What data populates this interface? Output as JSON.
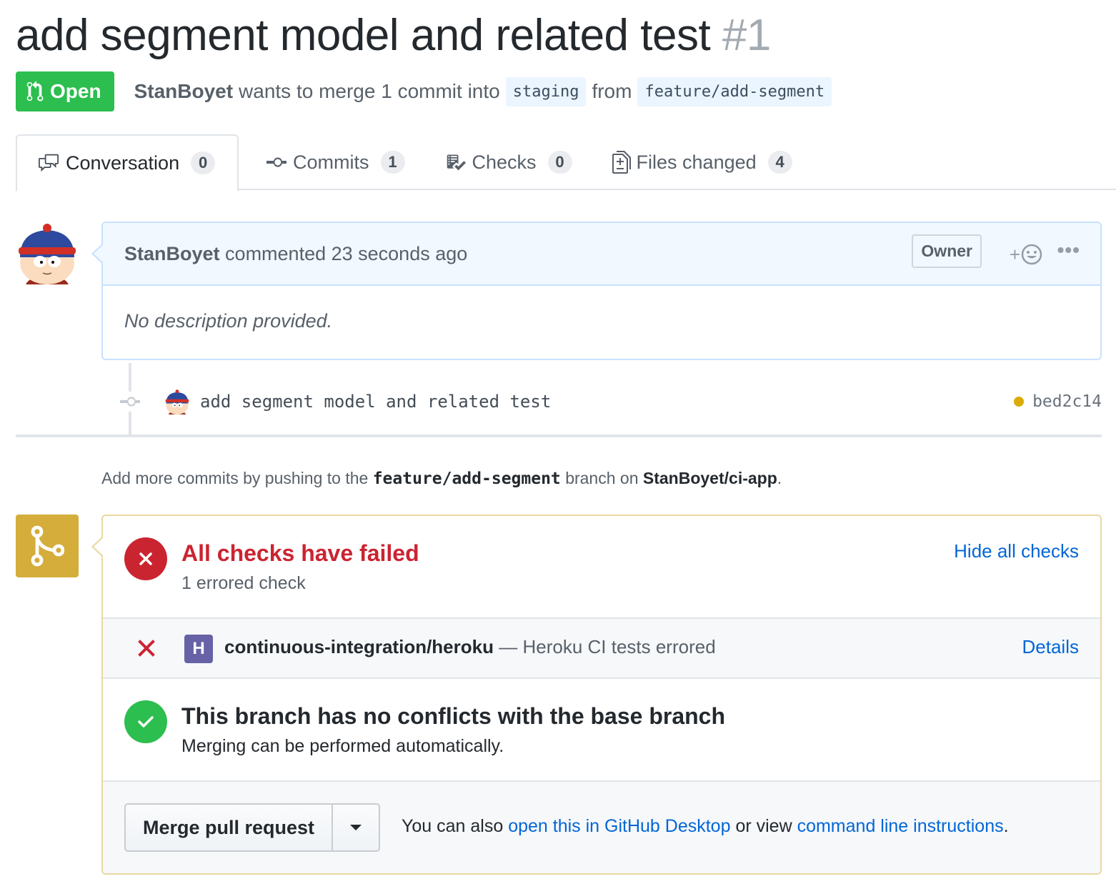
{
  "pr": {
    "title": "add segment model and related test",
    "number": "#1",
    "state": "Open",
    "author": "StanBoyet",
    "merge_text": "wants to merge 1 commit into",
    "base_branch": "staging",
    "from_text": "from",
    "head_branch": "feature/add-segment"
  },
  "tabs": [
    {
      "label": "Conversation",
      "count": "0",
      "icon": "comment-discussion-icon"
    },
    {
      "label": "Commits",
      "count": "1",
      "icon": "git-commit-icon"
    },
    {
      "label": "Checks",
      "count": "0",
      "icon": "checklist-icon"
    },
    {
      "label": "Files changed",
      "count": "4",
      "icon": "file-diff-icon"
    }
  ],
  "comment": {
    "author": "StanBoyet",
    "action": "commented 23 seconds ago",
    "badge": "Owner",
    "reaction_plus": "+",
    "more": "•••",
    "body": "No description provided."
  },
  "commit": {
    "message": "add segment model and related test",
    "sha": "bed2c14"
  },
  "push_note": {
    "prefix": "Add more commits by pushing to the",
    "branch": "feature/add-segment",
    "middle": "branch on",
    "repo": "StanBoyet/ci-app",
    "suffix": "."
  },
  "checks": {
    "title": "All checks have failed",
    "subtitle": "1 errored check",
    "toggle": "Hide all checks",
    "item_logo": "H",
    "item_name": "continuous-integration/heroku",
    "item_desc": "— Heroku CI tests errored",
    "item_link": "Details"
  },
  "conflicts": {
    "title": "This branch has no conflicts with the base branch",
    "subtitle": "Merging can be performed automatically."
  },
  "merge": {
    "button": "Merge pull request",
    "also": "You can also",
    "desktop_link": "open this in GitHub Desktop",
    "or_view": "or view",
    "cli_link": "command line instructions",
    "end": "."
  },
  "colors": {
    "open_green": "#2cbe4e",
    "fail_red": "#cb2431",
    "pending_yellow": "#dbab09",
    "link_blue": "#0366d6",
    "heroku_purple": "#6762a6"
  }
}
